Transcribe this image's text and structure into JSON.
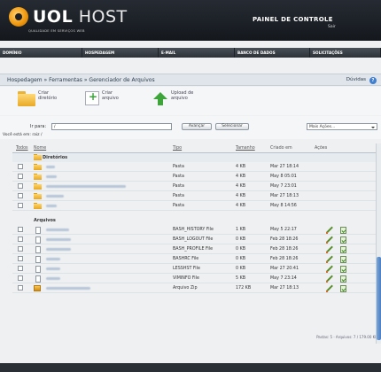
{
  "header": {
    "logo_bold": "UOL",
    "logo_light": "HOST",
    "tagline": "QUALIDADE EM SERVIÇOS WEB",
    "panel_title": "PAINEL DE CONTROLE",
    "sair": "Sair"
  },
  "nav": {
    "items": [
      "DOMÍNIO",
      "HOSPEDAGEM",
      "E-MAIL",
      "BANCO DE DADOS",
      "SOLICITAÇÕES"
    ]
  },
  "breadcrumb": {
    "path": "Hospedagem » Ferramentas » Gerenciador de Arquivos",
    "help": "Dúvidas"
  },
  "toolbar": {
    "create_dir": "Criar diretório",
    "create_file": "Criar arquivo",
    "upload": "Upload de arquivo"
  },
  "pathbar": {
    "ir_para": "Ir para:",
    "path_value": "/",
    "avancar": "Avançar",
    "selecionar": "Selecionar",
    "mais_acoes": "Mais Ações...",
    "location": "Você está em: raiz /"
  },
  "table": {
    "headers": {
      "todos": "Todos",
      "nome": "Nome",
      "tipo": "Tipo",
      "tamanho": "Tamanho",
      "criado": "Criado em",
      "acoes": "Ações"
    },
    "dir_section": "Diretórios",
    "file_section": "Arquivos",
    "dirs": [
      {
        "tipo": "Pasta",
        "size": "4 KB",
        "date": "Mar 27 18:14"
      },
      {
        "tipo": "Pasta",
        "size": "4 KB",
        "date": "May 8 05:01"
      },
      {
        "tipo": "Pasta",
        "size": "4 KB",
        "date": "May 7 23:01"
      },
      {
        "tipo": "Pasta",
        "size": "4 KB",
        "date": "Mar 27 18:13"
      },
      {
        "tipo": "Pasta",
        "size": "4 KB",
        "date": "May 8 14:56"
      }
    ],
    "files": [
      {
        "tipo": "BASH_HISTORY File",
        "size": "1 KB",
        "date": "May 5 22:17"
      },
      {
        "tipo": "BASH_LOGOUT File",
        "size": "0 KB",
        "date": "Feb 28 18:26"
      },
      {
        "tipo": "BASH_PROFILE File",
        "size": "0 KB",
        "date": "Feb 28 18:26"
      },
      {
        "tipo": "BASHRC File",
        "size": "0 KB",
        "date": "Feb 28 18:26"
      },
      {
        "tipo": "LESSHST File",
        "size": "0 KB",
        "date": "Mar 27 20:41"
      },
      {
        "tipo": "VIMINFO File",
        "size": "5 KB",
        "date": "May 7 23:14"
      },
      {
        "tipo": "Arquivo Zip",
        "size": "172 KB",
        "date": "Mar 27 18:13"
      }
    ]
  },
  "pager": "Pastas: 5 · Arquivos: 7 / 179.00 KB"
}
